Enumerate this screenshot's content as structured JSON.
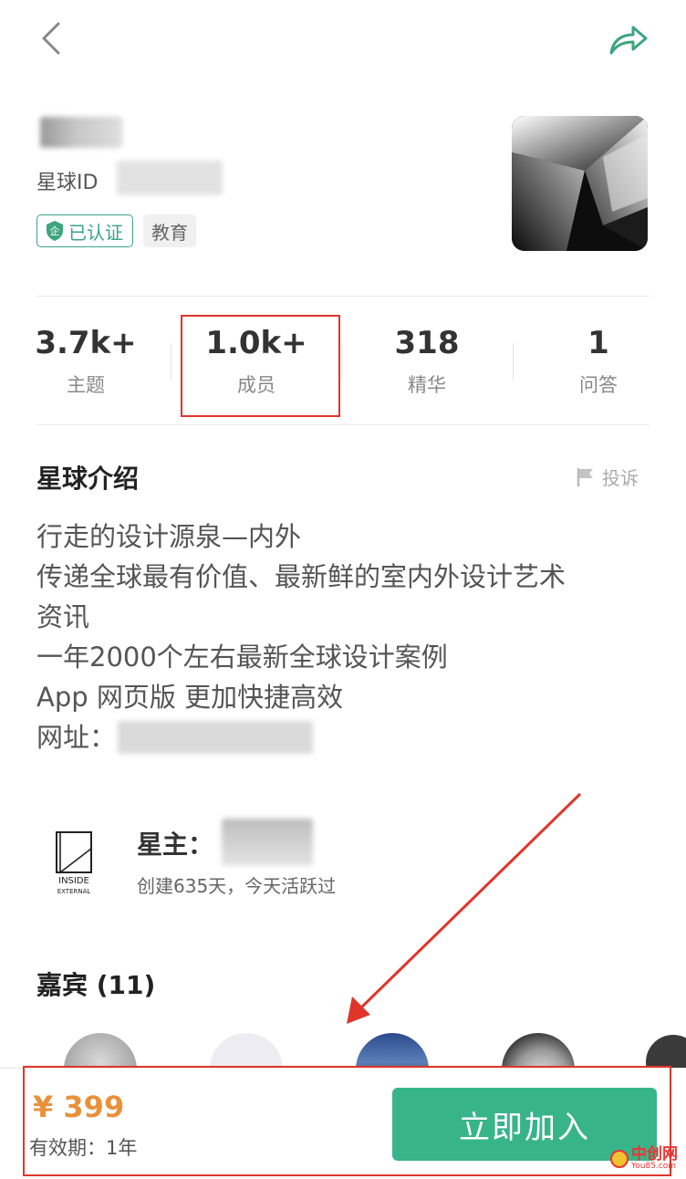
{
  "header": {
    "id_label": "星球ID",
    "verified_label": "已认证",
    "category_tag": "教育"
  },
  "stats": [
    {
      "value": "3.7k+",
      "label": "主题"
    },
    {
      "value": "1.0k+",
      "label": "成员"
    },
    {
      "value": "318",
      "label": "精华"
    },
    {
      "value": "1",
      "label": "问答"
    }
  ],
  "intro": {
    "title": "星球介绍",
    "report_label": "投诉",
    "lines": [
      "行走的设计源泉—内外",
      "传递全球最有价值、最新鲜的室内外设计艺术",
      "资讯",
      "一年2000个左右最新全球设计案例",
      "App 网页版 更加快捷高效",
      "网址："
    ]
  },
  "owner": {
    "label": "星主：",
    "meta": "创建635天，今天活跃过",
    "logo_text_1": "INSIDE",
    "logo_text_2": "EXTERNAL"
  },
  "guests": {
    "title": "嘉宾 (11)"
  },
  "purchase": {
    "price": "¥ 399",
    "validity": "有效期：1年",
    "join_label": "立即加入"
  },
  "watermark": {
    "text": "中创网",
    "sub": "You85.com"
  },
  "colors": {
    "accent_green": "#38b489",
    "price_orange": "#e8913a",
    "annotation_red": "#e0352b"
  },
  "icons": [
    "back-chevron-icon",
    "share-arrow-icon",
    "shield-icon",
    "flag-icon"
  ]
}
